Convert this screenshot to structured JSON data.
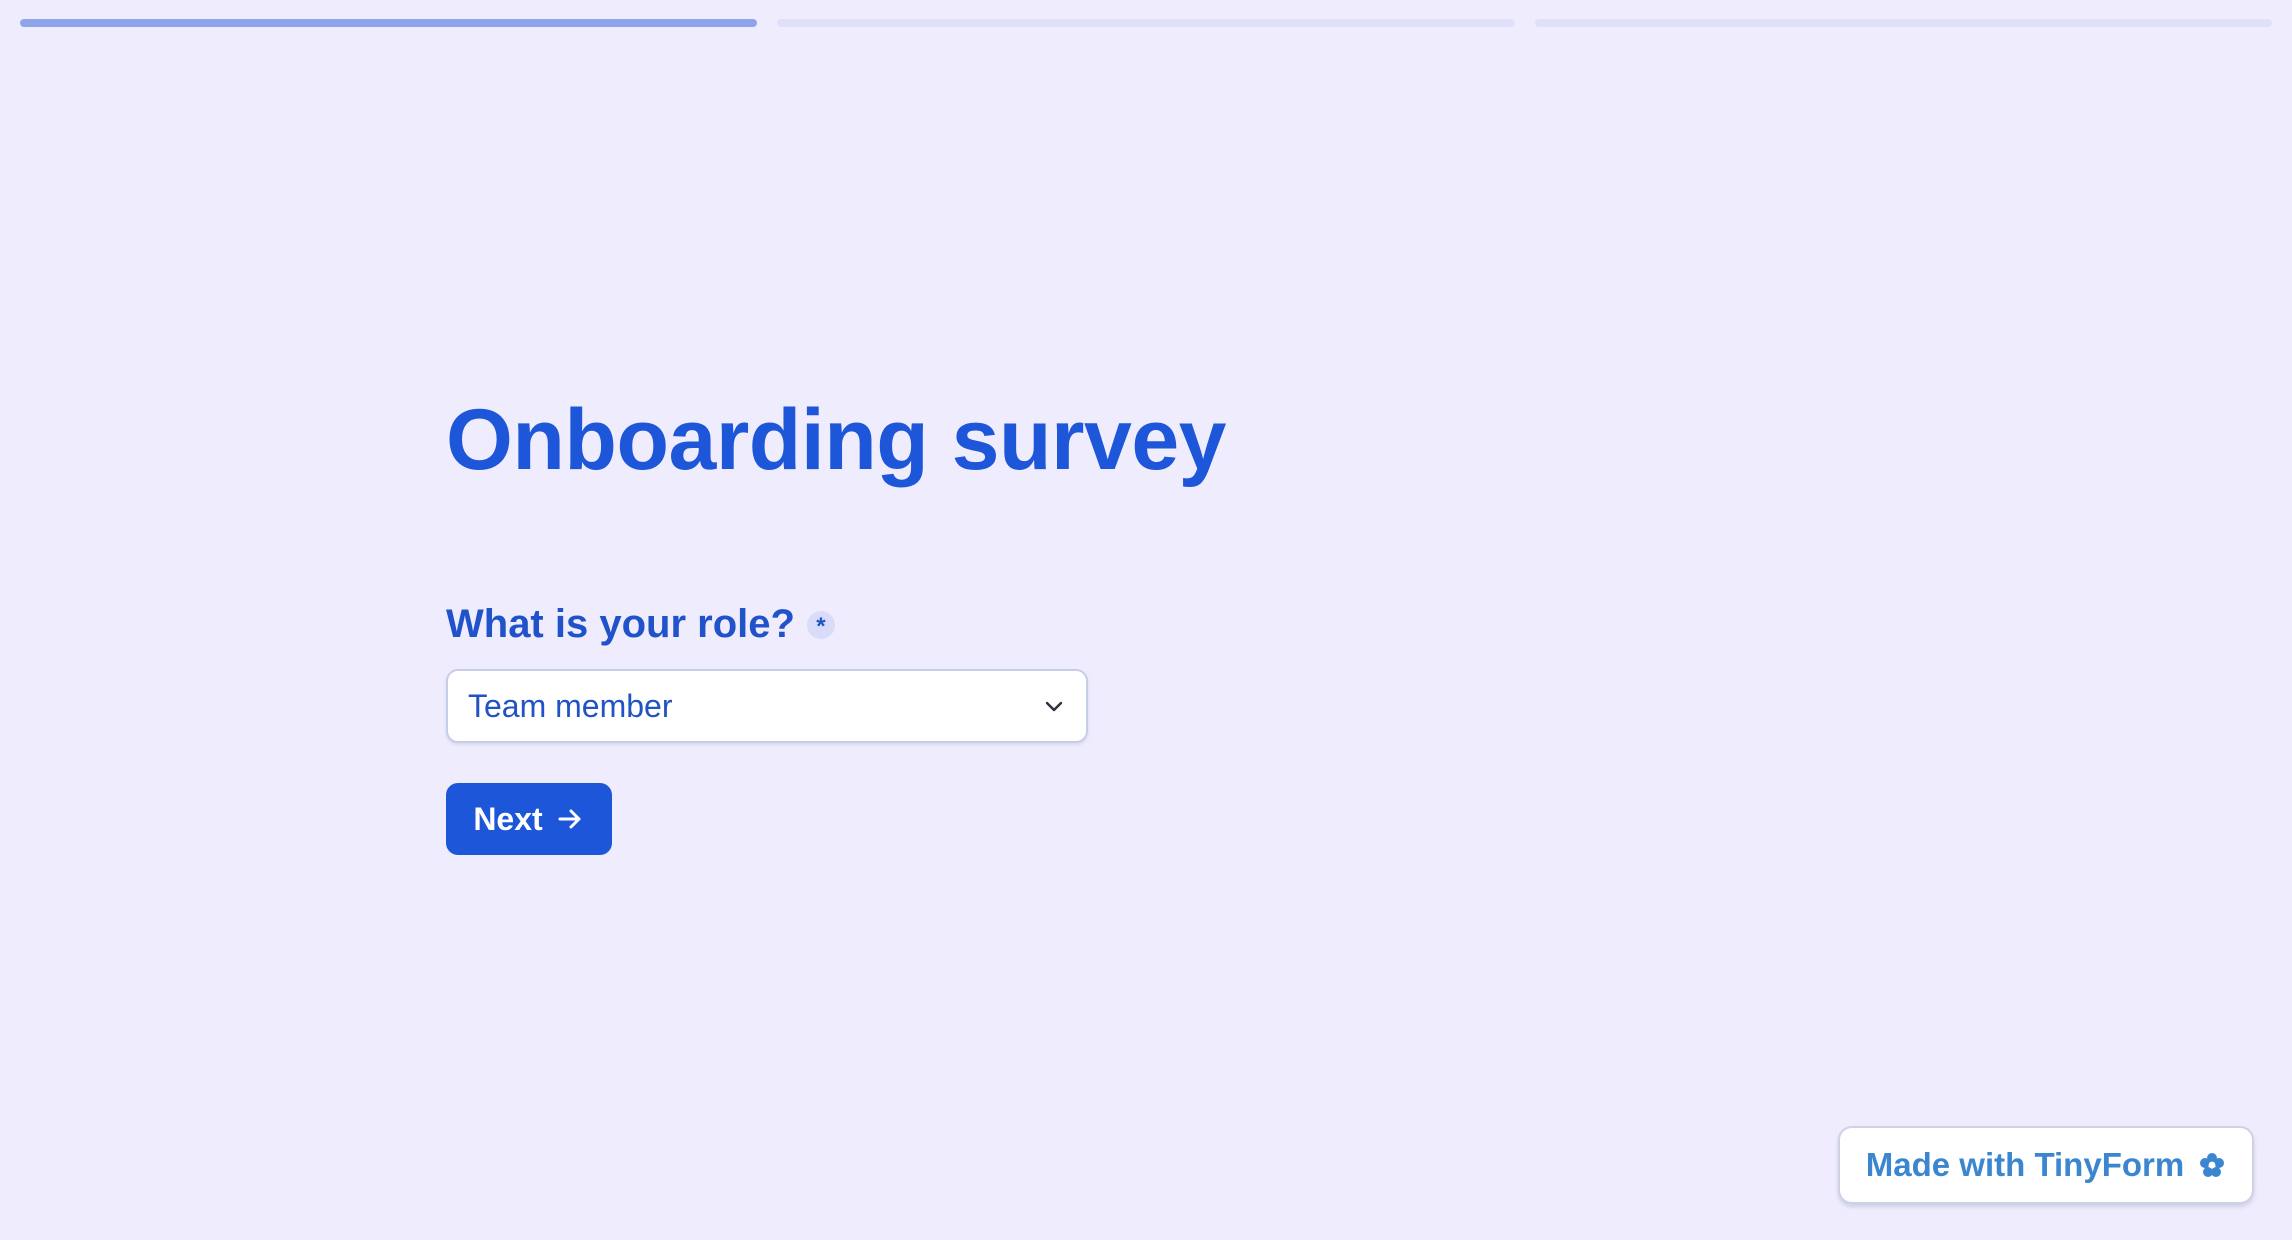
{
  "progress": {
    "total_steps": 3,
    "current_step": 1
  },
  "form": {
    "title": "Onboarding survey",
    "question": {
      "label": "What is your role?",
      "required_marker": "*",
      "selected_value": "Team member"
    },
    "next_button_label": "Next"
  },
  "badge": {
    "label": "Made with TinyForm",
    "icon": "flower-icon"
  },
  "colors": {
    "background": "#efedfd",
    "accent": "#1d56d8",
    "progress_active": "#8ea4ea",
    "progress_inactive": "#dfe1fb",
    "badge_text": "#3b86cf"
  }
}
